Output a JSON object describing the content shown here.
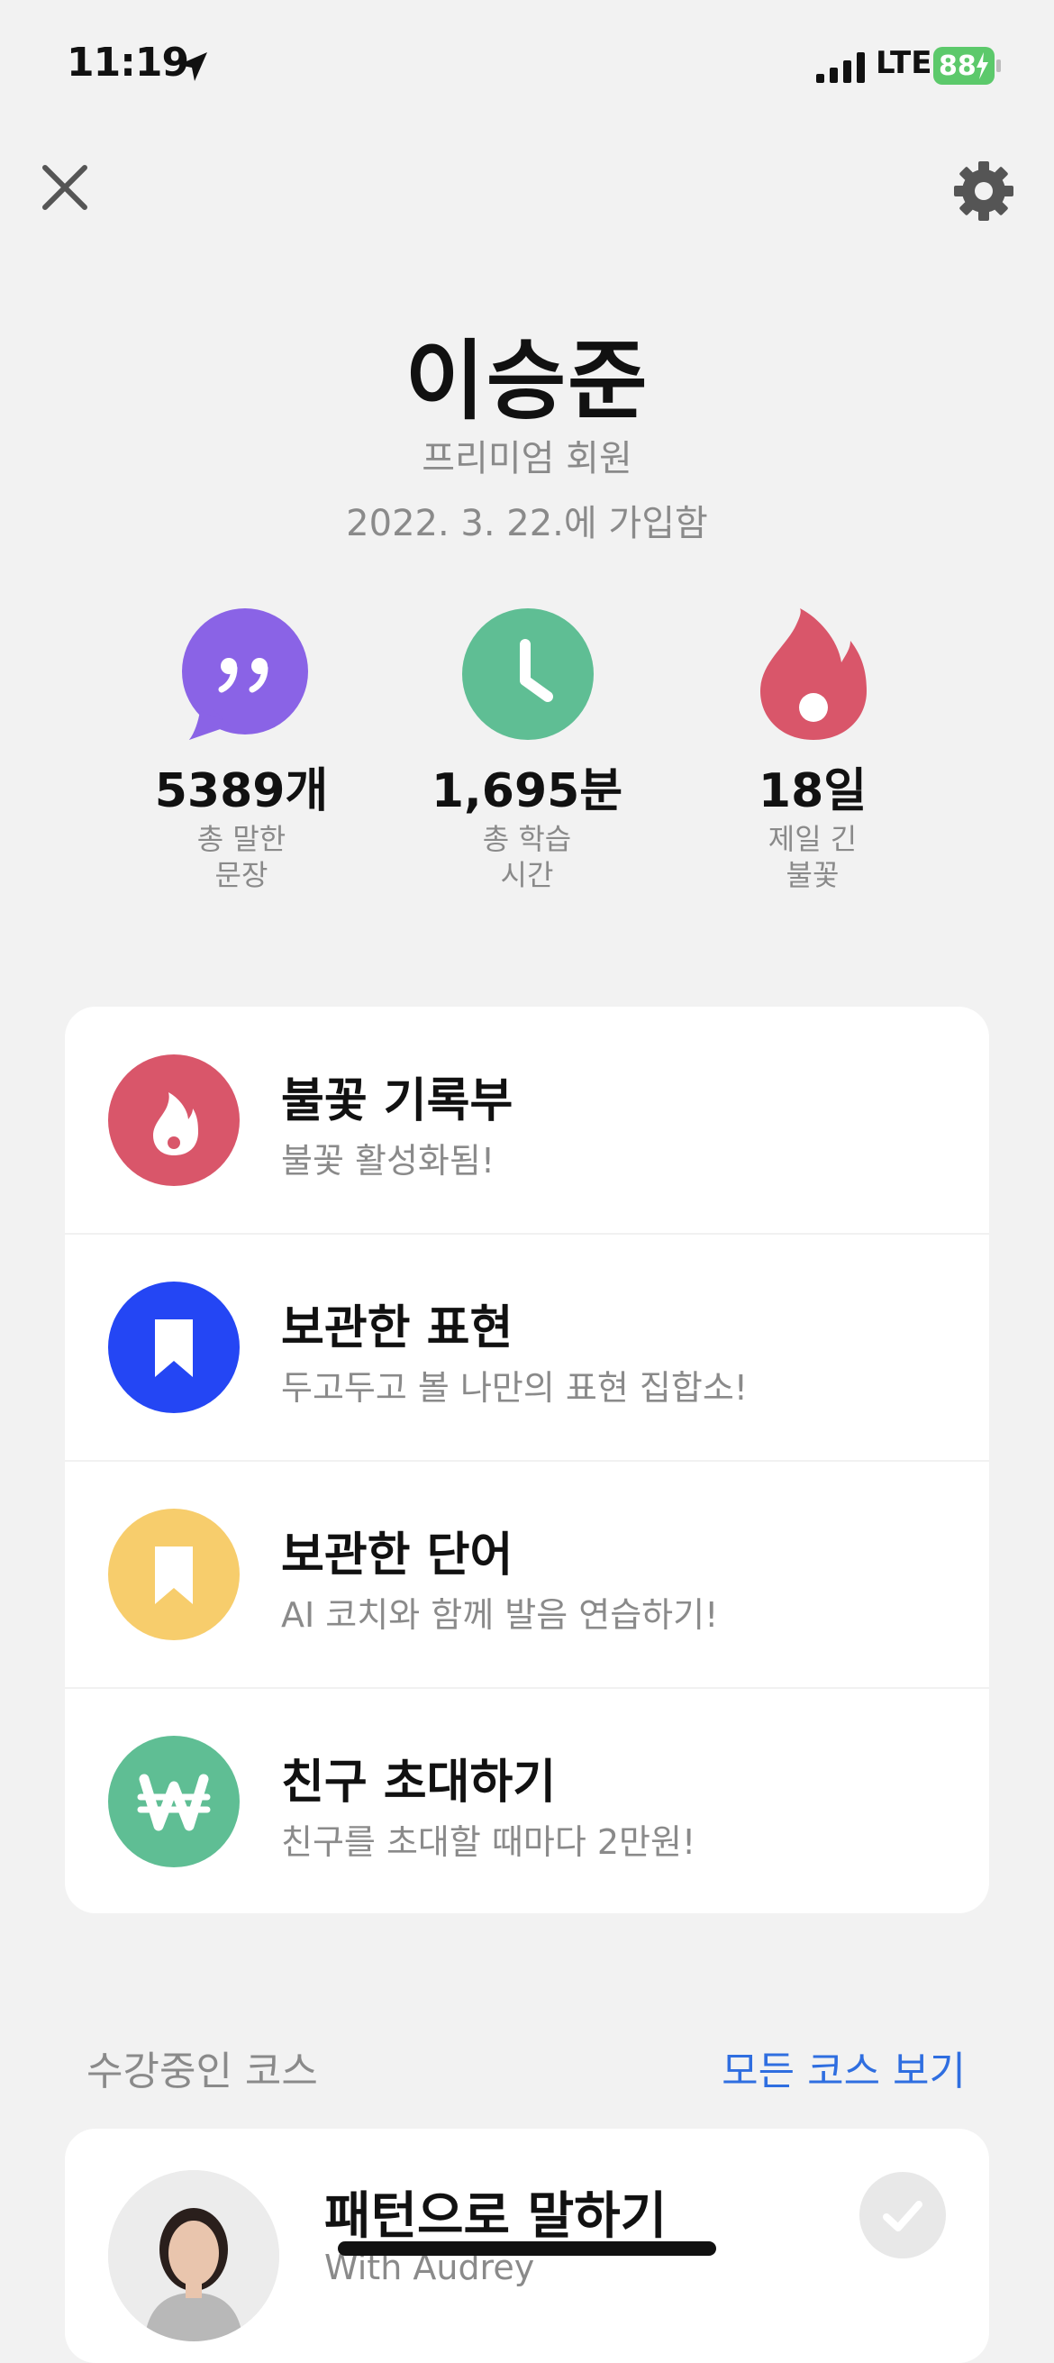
{
  "status_bar": {
    "time": "11:19",
    "network": "LTE",
    "battery": "88",
    "icons": [
      "location-arrow-icon",
      "signal-bars-icon",
      "battery-charging-icon"
    ]
  },
  "header": {
    "close_icon": "close-icon",
    "settings_icon": "gear-icon"
  },
  "profile": {
    "name": "이승준",
    "tier": "프리미엄 회원",
    "joined": "2022. 3. 22.에 가입함"
  },
  "stats": [
    {
      "value": "5389개",
      "label_line1": "총 말한",
      "label_line2": "문장",
      "icon": "quote-bubble-icon",
      "color": "#8a63e6"
    },
    {
      "value": "1,695분",
      "label_line1": "총 학습",
      "label_line2": "시간",
      "icon": "clock-icon",
      "color": "#5fbe94"
    },
    {
      "value": "18일",
      "label_line1": "제일 긴",
      "label_line2": "불꽃",
      "icon": "flame-icon",
      "color": "#d9566a"
    }
  ],
  "menu": [
    {
      "title": "불꽃 기록부",
      "subtitle": "불꽃 활성화됨!",
      "icon": "flame-icon",
      "color": "#d9566a"
    },
    {
      "title": "보관한 표현",
      "subtitle": "두고두고 볼 나만의 표현 집합소!",
      "icon": "bookmark-icon",
      "color": "#2446f4"
    },
    {
      "title": "보관한 단어",
      "subtitle": "AI 코치와 함께 발음 연습하기!",
      "icon": "bookmark-icon",
      "color": "#f7cd6c"
    },
    {
      "title": "친구 초대하기",
      "subtitle": "친구를 초대할 때마다 2만원!",
      "icon": "won-icon",
      "color": "#5fbe94"
    }
  ],
  "courses_section": {
    "title": "수강중인 코스",
    "link": "모든 코스 보기"
  },
  "course": {
    "title": "패턴으로 말하기",
    "subtitle": "With Audrey",
    "status_icon": "check-icon"
  },
  "colors": {
    "background": "#f2f2f2",
    "link": "#2f6ee0",
    "muted_text": "#8a8a8a"
  }
}
